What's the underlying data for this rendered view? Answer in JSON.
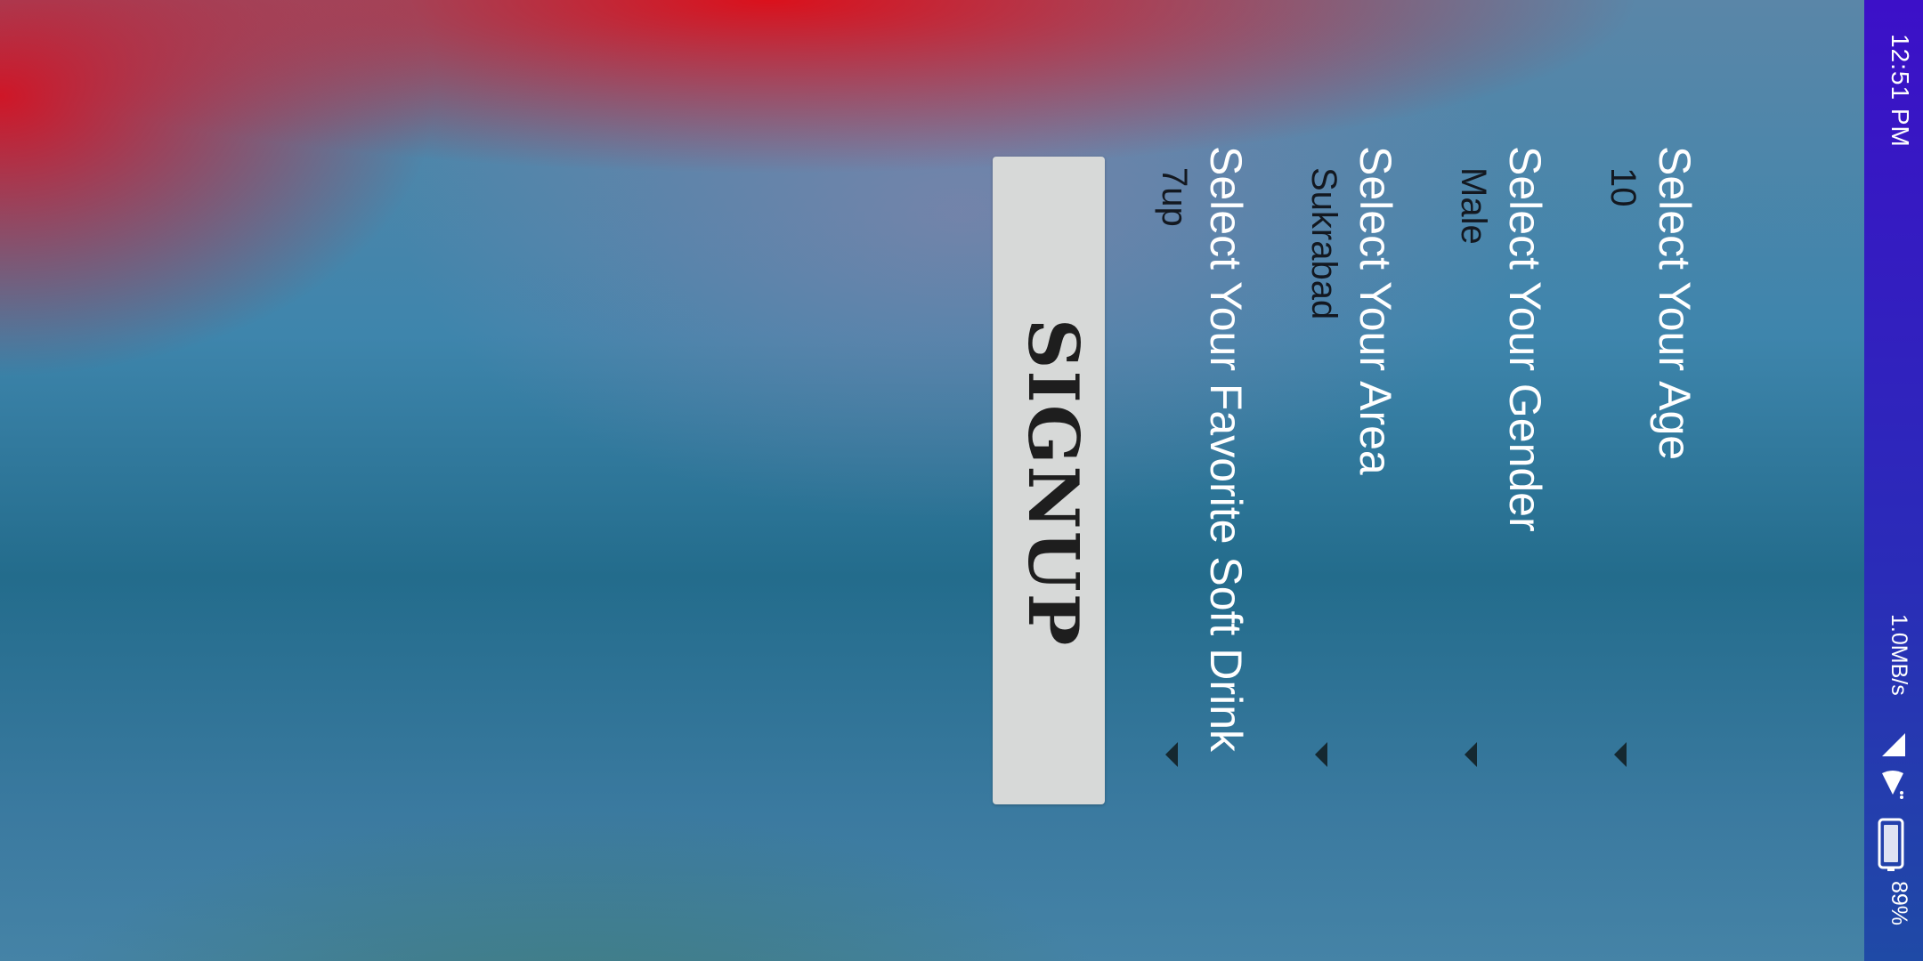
{
  "status_bar": {
    "time": "12:51 PM",
    "data_rate": "1.0MB/s",
    "battery": "89%"
  },
  "form": {
    "age_label": "Select Your Age",
    "age_value": "10",
    "gender_label": "Select Your Gender",
    "gender_value": "Male",
    "area_label": "Select Your Area",
    "area_value": "Sukrabad",
    "drink_label": "Select Your Favorite Soft Drink",
    "drink_value": "7up",
    "signup_label": "SIGNUP"
  },
  "colors": {
    "status_bar": "#3c10c8",
    "button_bg": "#d7d9d8"
  }
}
